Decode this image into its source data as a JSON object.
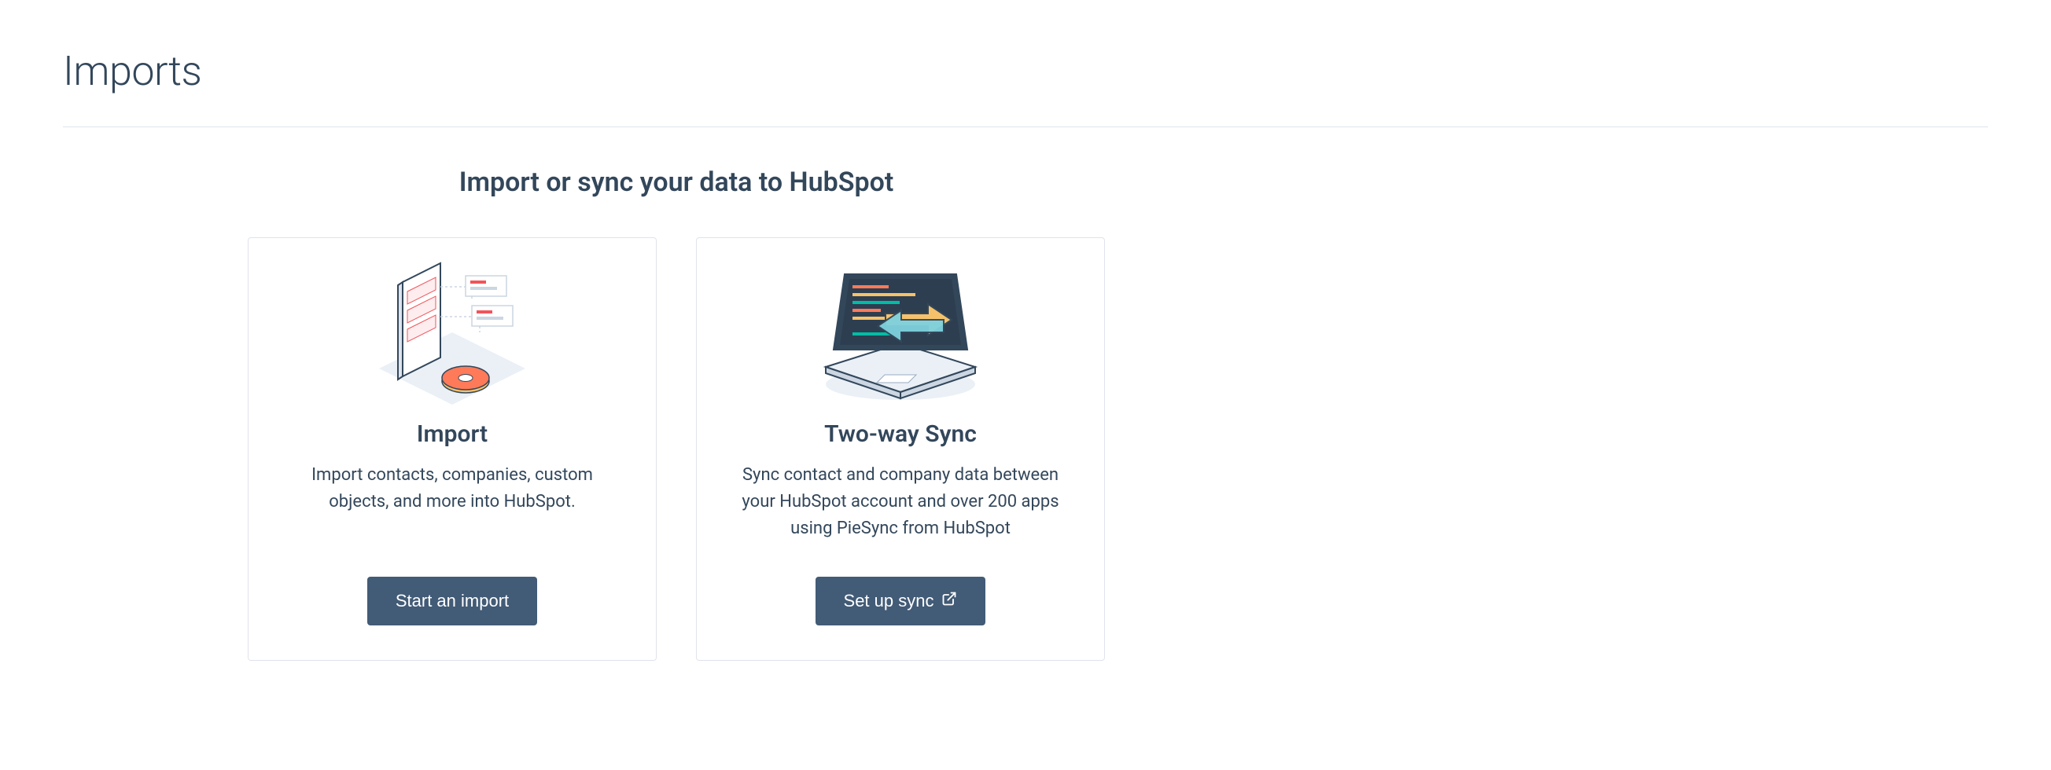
{
  "header": {
    "title": "Imports"
  },
  "subheading": "Import or sync your data to HubSpot",
  "cards": {
    "import": {
      "title": "Import",
      "description": "Import contacts, companies, custom objects, and more into HubSpot.",
      "button_label": "Start an import"
    },
    "sync": {
      "title": "Two-way Sync",
      "description": "Sync contact and company data between your HubSpot account and over 200 apps using PieSync from HubSpot",
      "button_label": "Set up sync"
    }
  }
}
